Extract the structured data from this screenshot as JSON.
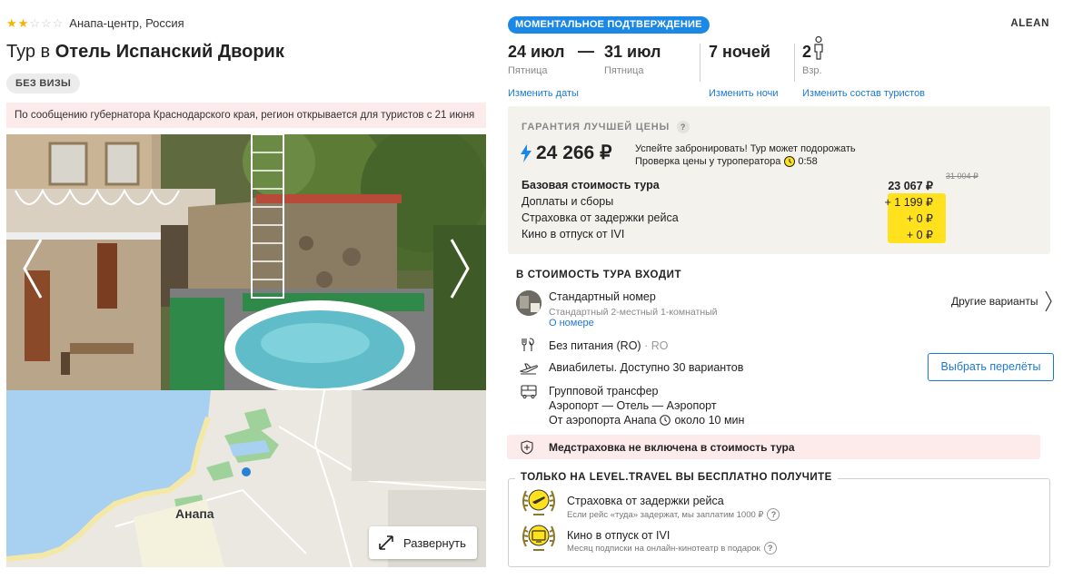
{
  "hotel": {
    "stars_filled": 2,
    "stars_total": 5,
    "location": "Анапа-центр, Россия",
    "title_prefix": "Тур в ",
    "title_name": "Отель Испанский Дворик",
    "visa_badge": "БЕЗ ВИЗЫ",
    "notice": "По сообщению губернатора Краснодарского края, регион открывается для туристов с 21 июня"
  },
  "map": {
    "city_label": "Анапа",
    "expand_label": "Развернуть"
  },
  "booking": {
    "instant_badge": "МОМЕНТАЛЬНОЕ ПОДТВЕРЖДЕНИЕ",
    "operator": "ALEAN",
    "date_from": "24 июл",
    "date_from_day": "Пятница",
    "separator": "—",
    "date_to": "31 июл",
    "date_to_day": "Пятница",
    "nights": "7 ночей",
    "tourists": "2",
    "tourists_label": "Взр.",
    "change_dates": "Изменить даты",
    "change_nights": "Изменить ночи",
    "change_tourists": "Изменить состав туристов"
  },
  "price": {
    "guarantee": "ГАРАНТИЯ ЛУЧШЕЙ ЦЕНЫ",
    "guarantee_help": "?",
    "total": "24 266 ₽",
    "hurry_line1": "Успейте забронировать! Тур может подорожать",
    "hurry_line2": "Проверка цены у туроператора",
    "timer": "0:58",
    "old_price": "31 004 ₽",
    "breakdown": [
      {
        "label": "Базовая стоимость тура",
        "value": "23 067 ₽"
      },
      {
        "label": "Доплаты и сборы",
        "value": "+ 1 199 ₽"
      },
      {
        "label": "Страховка от задержки рейса",
        "value": "+ 0 ₽"
      },
      {
        "label": "Кино в отпуск от IVI",
        "value": "+ 0 ₽"
      }
    ]
  },
  "includes": {
    "title": "В СТОИМОСТЬ ТУРА ВХОДИТ",
    "room_name": "Стандартный номер",
    "room_desc": "Стандартный 2-местный 1-комнатный",
    "room_link": "О номере",
    "other_variants": "Другие варианты",
    "meal": "Без питания (RO)",
    "meal_sep": " · ",
    "meal_code": "RO",
    "flights": "Авиабилеты. Доступно 30 вариантов",
    "flights_button": "Выбрать перелёты",
    "transfer_title": "Групповой трансфер",
    "transfer_route": "Аэропорт — Отель — Аэропорт",
    "transfer_time_prefix": "От аэропорта Анапа",
    "transfer_time": "около 10 мин",
    "insurance_warning": "Медстраховка не включена в стоимость тура"
  },
  "bonus": {
    "title": "ТОЛЬКО НА LEVEL.TRAVEL ВЫ БЕСПЛАТНО ПОЛУЧИТЕ",
    "items": [
      {
        "name": "Страховка от задержки рейса",
        "sub": "Если рейс «туда» задержат, мы заплатим 1000 ₽"
      },
      {
        "name": "Кино в отпуск от IVI",
        "sub": "Месяц подписки на онлайн-кинотеатр в подарок"
      }
    ]
  },
  "colors": {
    "accent": "#1c88e6",
    "link": "#1c78d6",
    "highlight": "#ffe11e",
    "warning_bg": "#fdeaea",
    "price_box_bg": "#f3f2ec",
    "star": "#f4b400"
  }
}
